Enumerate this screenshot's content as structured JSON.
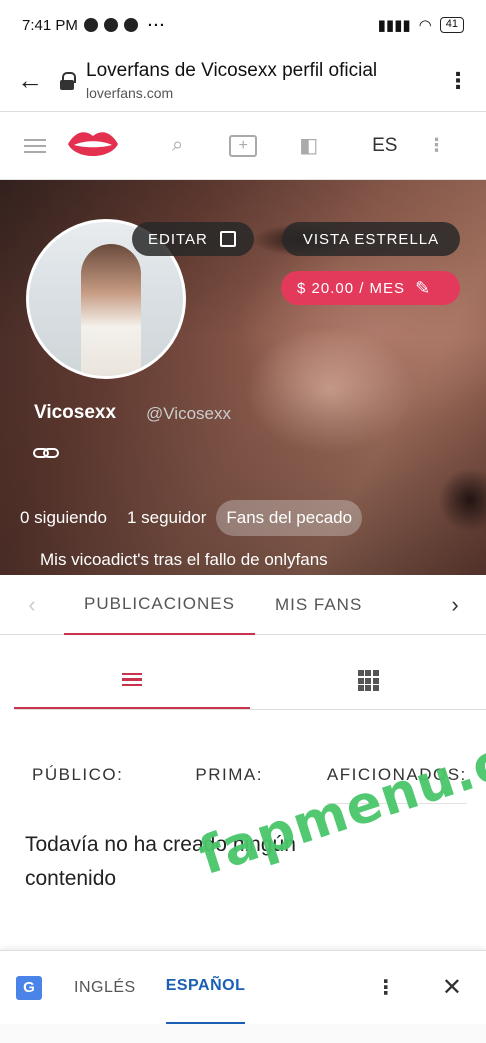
{
  "status_bar": {
    "time": "7:41 PM",
    "dots": "···",
    "battery": "41"
  },
  "browser": {
    "title": "Loverfans de Vicosexx perfil oficial",
    "domain": "loverfans.com"
  },
  "site_header": {
    "language": "ES"
  },
  "profile": {
    "edit_label": "EDITAR",
    "star_view_label": "VISTA ESTRELLA",
    "price_label": "$ 20.00 / MES",
    "name": "Vicosexx",
    "handle": "@Vicosexx",
    "following": "0 siguiendo",
    "followers": "1 seguidor",
    "fans_group": "Fans del pecado",
    "bio": "Mis vicoadict's tras el fallo de onlyfans"
  },
  "tabs": [
    {
      "label": "PUBLICACIONES",
      "active": true
    },
    {
      "label": "MIS FANS",
      "active": false
    }
  ],
  "columns": {
    "public": "PÚBLICO:",
    "premium": "PRIMA:",
    "fans": "AFICIONADOS:"
  },
  "empty_message": "Todavía no ha creado ningún contenido",
  "watermark": "fapmenu.com",
  "translate_bar": {
    "source": "INGLÉS",
    "target": "ESPAÑOL"
  },
  "colors": {
    "accent": "#c8344d",
    "price_pill": "#e33a5b",
    "watermark": "#49c66a",
    "translate_active": "#1a5fb4"
  }
}
